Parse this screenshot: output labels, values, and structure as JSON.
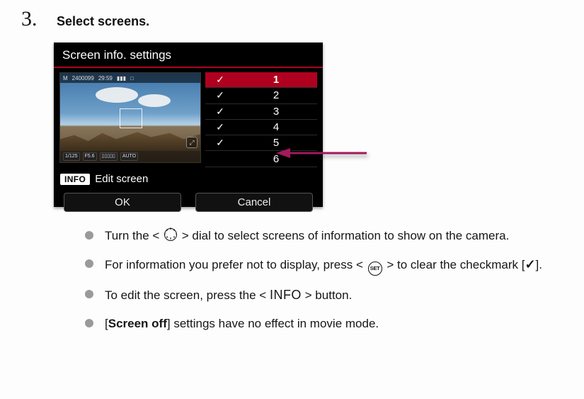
{
  "step": {
    "number": "3.",
    "title": "Select screens."
  },
  "camera": {
    "title": "Screen info. settings",
    "preview_overlay": {
      "mode": "M",
      "shots": "2400099",
      "time": "29:59",
      "battery": "▮▮▮",
      "aux_icon": "□",
      "shutter": "1/125",
      "aperture": "F5.6",
      "exp_comp": "▯▯▯▯▯",
      "iso_auto": "AUTO",
      "magnify": "⤢"
    },
    "list": [
      {
        "checked": true,
        "label": "1",
        "selected": true
      },
      {
        "checked": true,
        "label": "2",
        "selected": false
      },
      {
        "checked": true,
        "label": "3",
        "selected": false
      },
      {
        "checked": true,
        "label": "4",
        "selected": false
      },
      {
        "checked": true,
        "label": "5",
        "selected": false
      },
      {
        "checked": false,
        "label": "6",
        "selected": false
      }
    ],
    "info_badge": "INFO",
    "edit_label": "Edit screen",
    "ok_label": "OK",
    "cancel_label": "Cancel"
  },
  "bullets": {
    "b1_pre": "Turn the < ",
    "b1_post": " > dial to select screens of information to show on the camera.",
    "b2_pre": "For information you prefer not to display, press < ",
    "b2_mid": " > to clear the checkmark [",
    "b2_check": "✓",
    "b2_post": "].",
    "b3_pre": "To edit the screen, press the < ",
    "b3_info": "INFO",
    "b3_post": " > button.",
    "b4_pre": "[",
    "b4_bold": "Screen off",
    "b4_post": "] settings have no effect in movie mode.",
    "set_label": "SET"
  }
}
